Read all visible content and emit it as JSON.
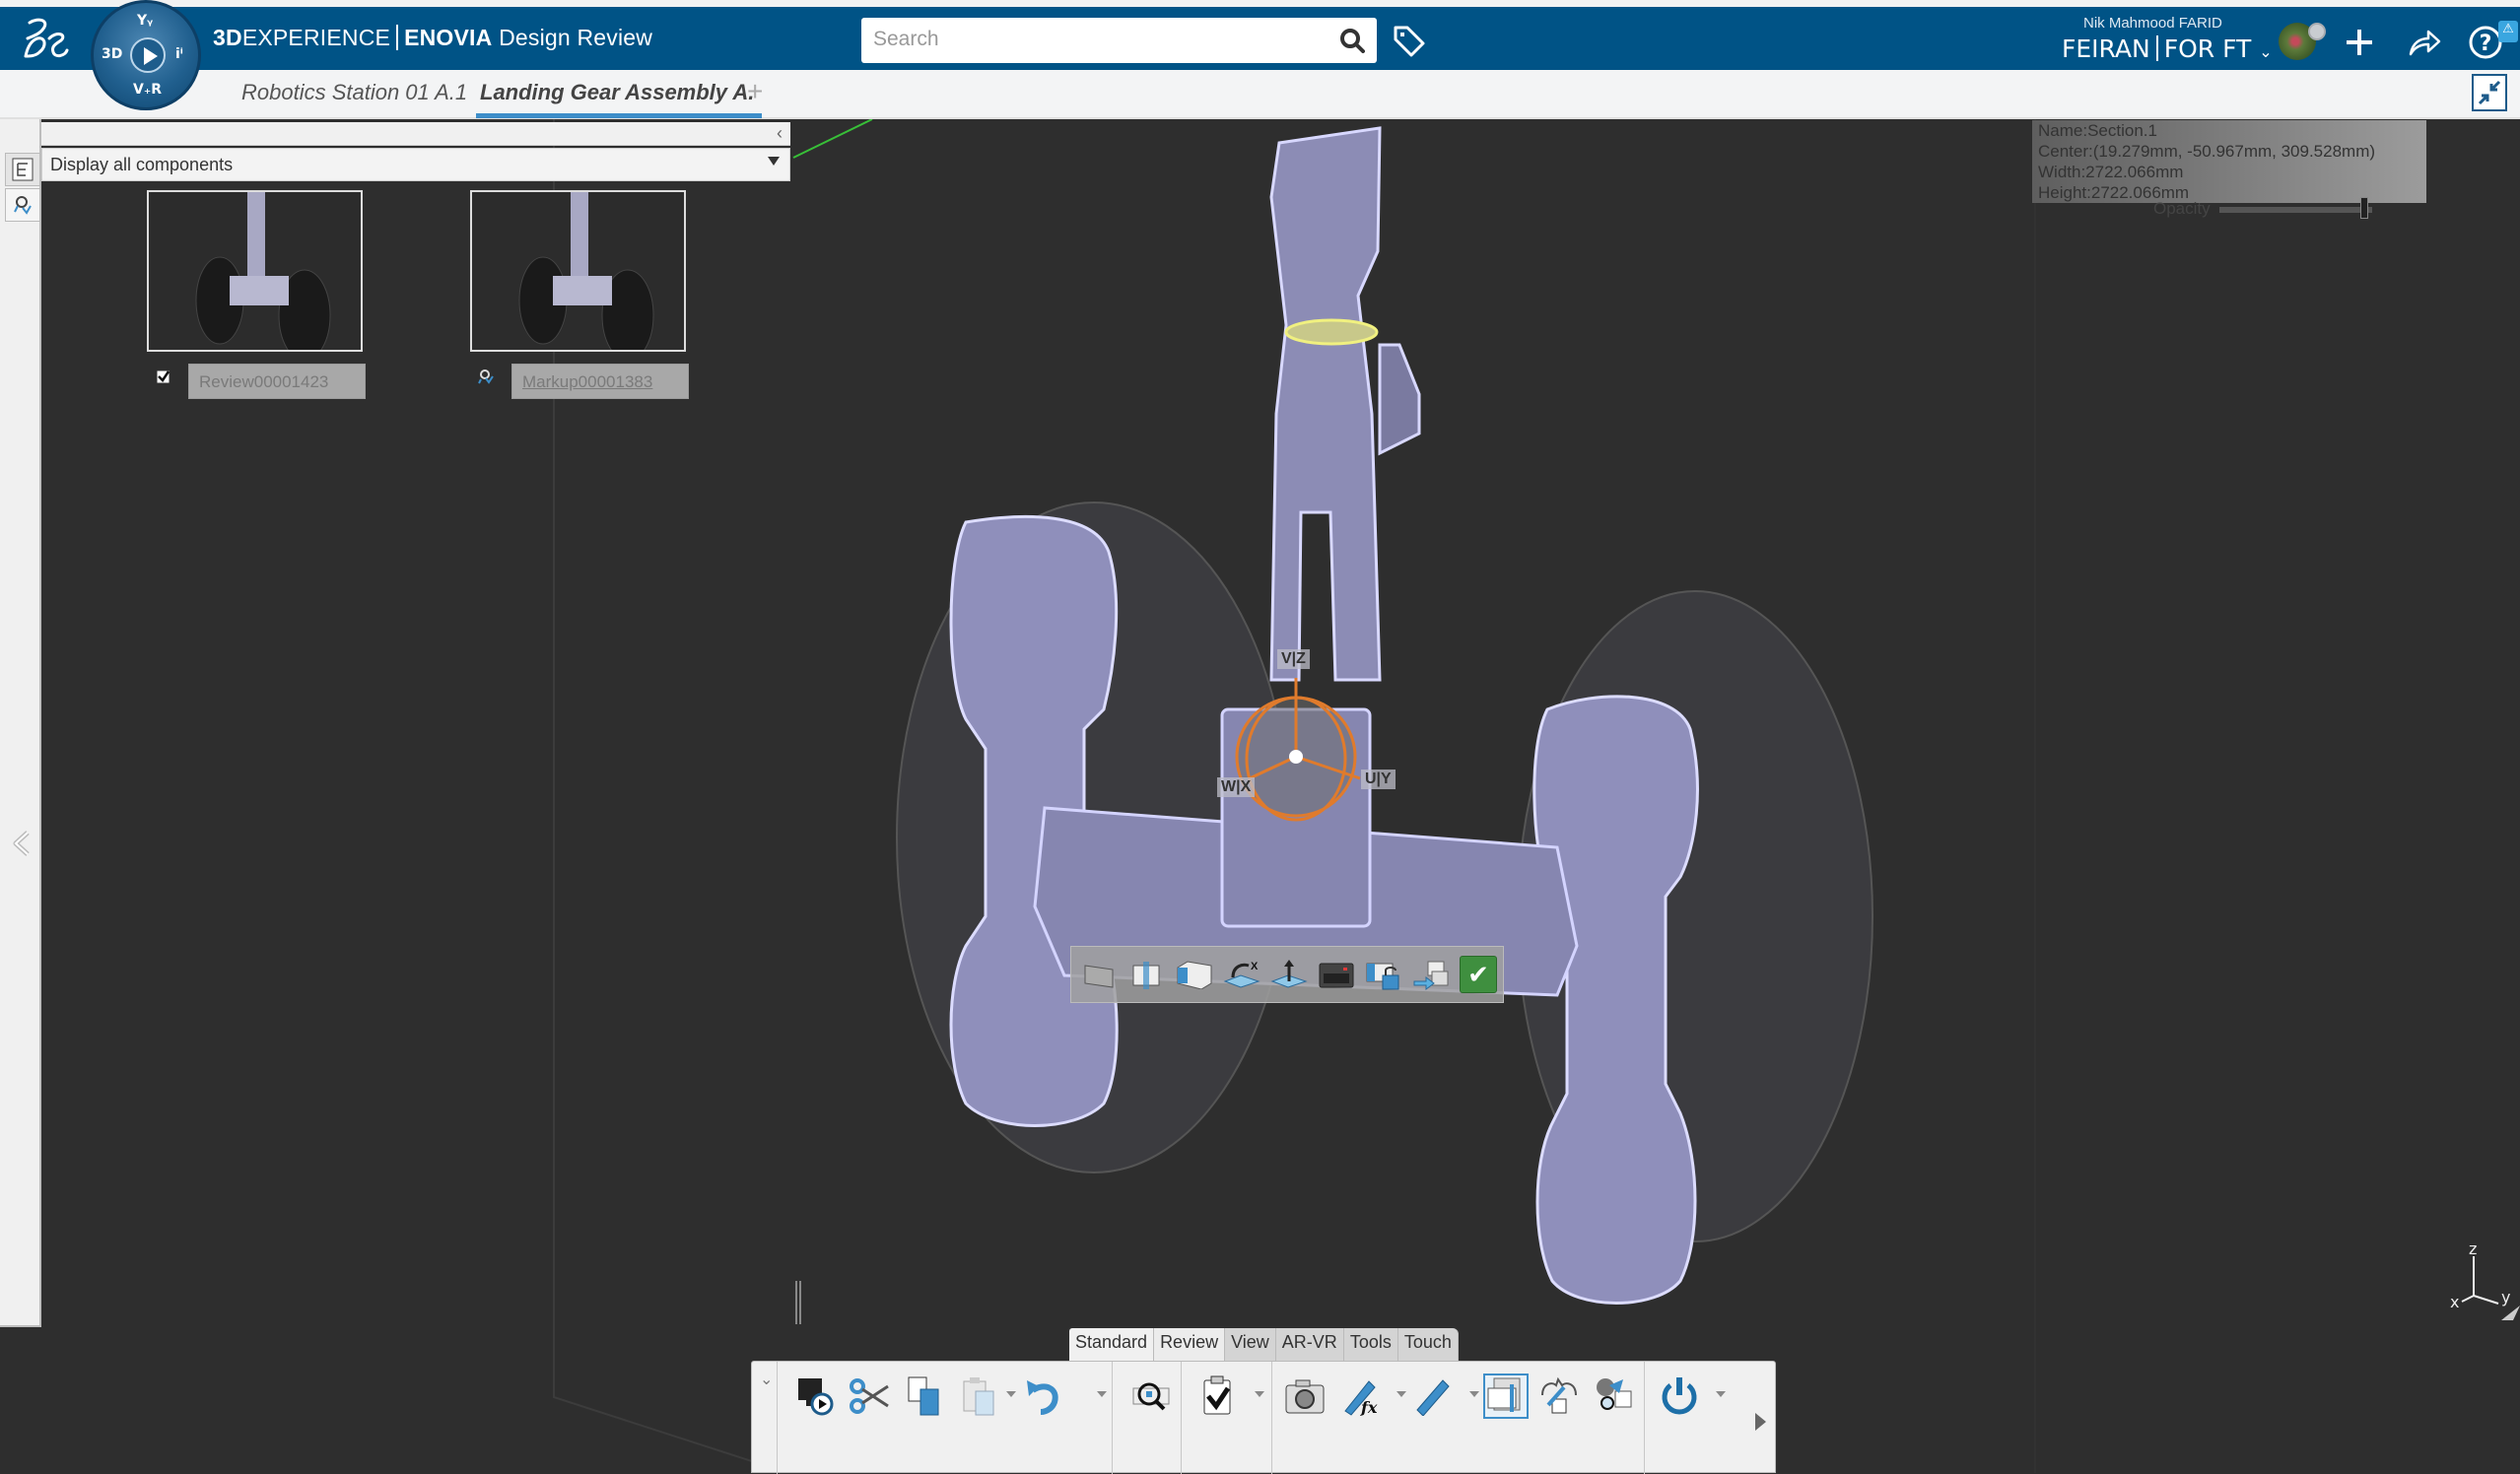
{
  "header": {
    "brand_prefix": "3D",
    "brand_main": "EXPERIENCE",
    "app_name": "ENOVIA",
    "app_role": "Design Review",
    "compass": {
      "top": "Yᵧ",
      "left": "3D",
      "right": "iⁱ",
      "bottom": "V₊R"
    },
    "search_placeholder": "Search",
    "user_name": "Nik  Mahmood FARID",
    "tenant_left": "FEIRAN",
    "tenant_right": "FOR FT",
    "alert_badge": "⚠",
    "icons": [
      "ds-logo",
      "compass",
      "search-icon",
      "tag-icon",
      "avatar",
      "add-icon",
      "share-icon",
      "help-icon"
    ]
  },
  "tabs": [
    {
      "label": "Robotics Station 01 A.1",
      "active": false
    },
    {
      "label": "Landing Gear Assembly A.",
      "active": true
    }
  ],
  "tab_add_label": "+",
  "left_panel": {
    "filter_value": "Display all components",
    "collapse_label": "‹",
    "items": [
      {
        "name": "Review00001423",
        "type": "review",
        "icon": "review-check-icon"
      },
      {
        "name": "Markup00001383",
        "type": "markup",
        "icon": "markup-icon"
      }
    ]
  },
  "section_info": {
    "name": "Name:Section.1",
    "center": "Center:(19.279mm, -50.967mm, 309.528mm)",
    "width": "Width:2722.066mm",
    "height": "Height:2722.066mm",
    "opacity_label": "Opacity",
    "opacity_value": 0.95
  },
  "gizmo": {
    "v": "V|Z",
    "u": "U|Y",
    "w": "W|X"
  },
  "axes": {
    "x": "x",
    "y": "y",
    "z": "z"
  },
  "section_toolbar": [
    "section-plane-icon",
    "section-slice-icon",
    "section-volume-icon",
    "reverse-direction-icon",
    "normal-constraint-icon",
    "result-window-icon",
    "lock-section-icon",
    "export-section-icon",
    "validate-icon"
  ],
  "bottom_tabs": [
    {
      "label": "Standard",
      "active": true
    },
    {
      "label": "Review",
      "active": false
    },
    {
      "label": "View",
      "active": false
    },
    {
      "label": "AR-VR",
      "active": false
    },
    {
      "label": "Tools",
      "active": false
    },
    {
      "label": "Touch",
      "active": false
    }
  ],
  "toolbar_actions": [
    "present-icon",
    "cut-icon",
    "copy-icon",
    "paste-icon",
    "undo-icon",
    "zoom-fit-icon",
    "review-check-icon",
    "capture-icon",
    "annotate-icon",
    "measure-icon",
    "sectioning-icon",
    "clash-icon",
    "compare-icon",
    "exit-icon"
  ]
}
